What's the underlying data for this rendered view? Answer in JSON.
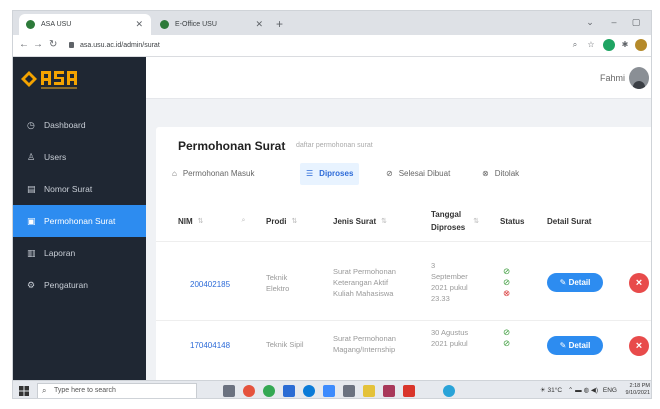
{
  "browser": {
    "tabs": [
      {
        "title": "ASA USU",
        "active": true
      },
      {
        "title": "E-Office USU",
        "active": false
      }
    ],
    "url": "asa.usu.ac.id/admin/surat"
  },
  "app": {
    "user_name": "Fahmi",
    "sidebar": {
      "items": [
        {
          "label": "Dashboard",
          "icon": "dashboard-icon"
        },
        {
          "label": "Users",
          "icon": "user-icon"
        },
        {
          "label": "Nomor Surat",
          "icon": "list-icon"
        },
        {
          "label": "Permohonan Surat",
          "icon": "document-icon",
          "active": true
        },
        {
          "label": "Laporan",
          "icon": "report-icon"
        },
        {
          "label": "Pengaturan",
          "icon": "gear-icon"
        }
      ]
    },
    "page": {
      "title": "Permohonan Surat",
      "subtitle": "daftar permohonan surat",
      "tabs": [
        {
          "label": "Permohonan Masuk",
          "icon": "inbox-icon"
        },
        {
          "label": "Diproses",
          "icon": "process-icon",
          "active": true
        },
        {
          "label": "Selesai Dibuat",
          "icon": "check-circle-icon"
        },
        {
          "label": "Ditolak",
          "icon": "x-circle-icon"
        }
      ],
      "columns": {
        "nim": "NIM",
        "prodi": "Prodi",
        "jenis": "Jenis Surat",
        "tanggal_line1": "Tanggal",
        "tanggal_line2": "Diproses",
        "status": "Status",
        "detail": "Detail Surat"
      },
      "rows": [
        {
          "nim": "200402185",
          "prodi": [
            "Teknik",
            "Elektro"
          ],
          "jenis": [
            "Surat Permohonan",
            "Keterangan Aktif",
            "Kuliah Mahasiswa"
          ],
          "tanggal": [
            "3",
            "September",
            "2021 pukul",
            "23.33"
          ],
          "status": [
            "ok",
            "ok",
            "no"
          ]
        },
        {
          "nim": "170404148",
          "prodi": [
            "Teknik Sipil"
          ],
          "jenis": [
            "Surat Permohonan",
            "Magang/Internship"
          ],
          "tanggal": [
            "30 Agustus",
            "2021 pukul"
          ],
          "status": [
            "ok",
            "ok"
          ]
        }
      ],
      "detail_label": "Detail"
    }
  },
  "taskbar": {
    "search_placeholder": "Type here to search",
    "temperature": "31°C",
    "lang": "ENG",
    "time": "2:18 PM",
    "date": "9/10/2021"
  }
}
